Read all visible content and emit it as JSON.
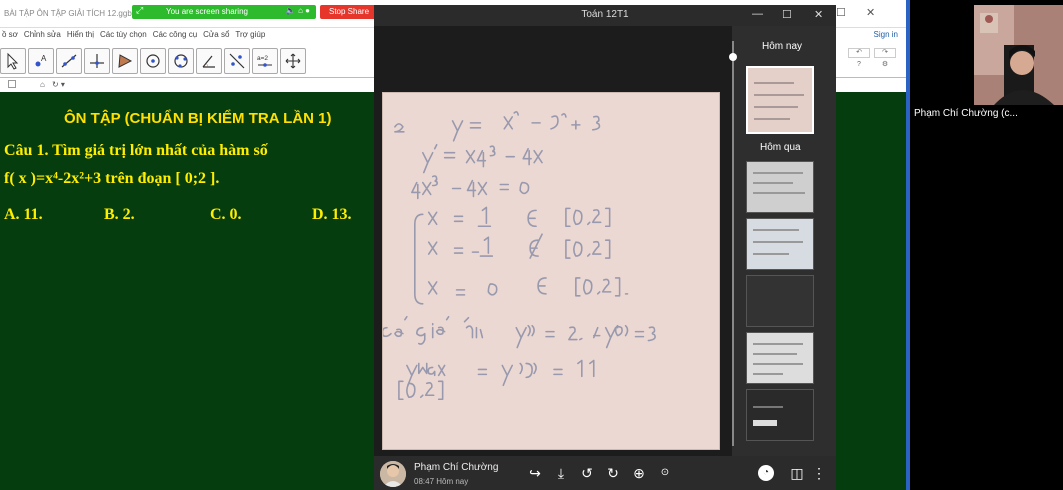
{
  "geogebra": {
    "title": "BÀI TẬP ÔN TẬP GIẢI TÍCH 12.ggb",
    "menu": [
      "ồ sơ",
      "Chỉnh sửa",
      "Hiển thị",
      "Các tùy chọn",
      "Các công cụ",
      "Cửa sổ",
      "Trợ giúp"
    ],
    "sign_in": "Sign in",
    "heading": "ÔN TẬP  (CHUẨN BỊ KIỂM  TRA LẦN 1)",
    "question_line1": "Câu 1. Tìm giá trị lớn nhất của hàm số",
    "question_line2": "f( x )=x⁴-2x²+3 trên đoạn [ 0;2 ].",
    "answers": [
      "A. 11.",
      "B. 2.",
      "C. 0.",
      "D. 13."
    ],
    "tool_label_a2": "a=2"
  },
  "share": {
    "banner_text": "You are screen sharing",
    "stop_label": "Stop Share"
  },
  "viewer": {
    "title": "Toán 12T1",
    "today_label": "Hôm nay",
    "yesterday_label": "Hôm qua",
    "user_name": "Phạm Chí Chường",
    "time": "08:47 Hôm nay"
  },
  "participant": {
    "name": "Phạm Chí Chường (c..."
  },
  "colors": {
    "geo_background": "#063d0e",
    "geo_text": "#ffee00",
    "share_green": "#2dbb2d",
    "stop_red": "#e6362c"
  }
}
